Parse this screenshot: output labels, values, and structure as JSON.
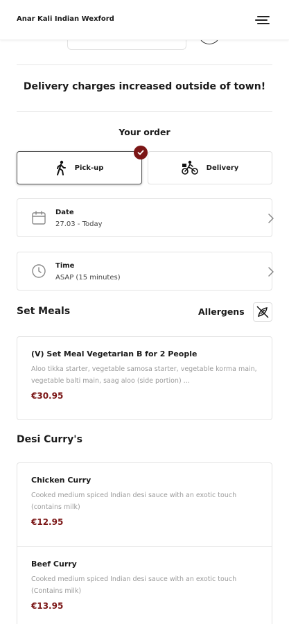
{
  "header": {
    "title": "Anar Kali Indian Wexford",
    "menu_icon": "hamburger-menu-icon"
  },
  "notice": "Delivery charges increased outside of town!",
  "order": {
    "heading": "Your order",
    "options": [
      {
        "label": "Pick-up",
        "icon": "walking-person-icon",
        "selected": true
      },
      {
        "label": "Delivery",
        "icon": "bicycle-courier-icon",
        "selected": false
      }
    ],
    "date": {
      "label": "Date",
      "value": "27.03 - Today"
    },
    "time": {
      "label": "Time",
      "value": "ASAP (15 minutes)"
    }
  },
  "sections": [
    {
      "title": "Set Meals",
      "allergens_label": "Allergens",
      "items": [
        {
          "name": "(V) Set Meal Vegetarian B for 2 People",
          "description": "Aloo tikka starter, vegetable samosa starter, vegetable korma main, vegetable balti main, saag aloo (side portion) ...",
          "price": "€30.95"
        }
      ]
    },
    {
      "title": "Desi Curry's",
      "items": [
        {
          "name": "Chicken Curry",
          "description": "Cooked medium spiced Indian desi sauce with an exotic touch (contains milk)",
          "price": "€12.95"
        },
        {
          "name": "Beef Curry",
          "description": "Cooked medium spiced Indian desi sauce with an exotic touch (Contains milk)",
          "price": "€13.95"
        }
      ]
    }
  ],
  "colors": {
    "accent": "#7b1616",
    "border": "#e3e3e3",
    "muted_text": "#9a9a9a"
  }
}
